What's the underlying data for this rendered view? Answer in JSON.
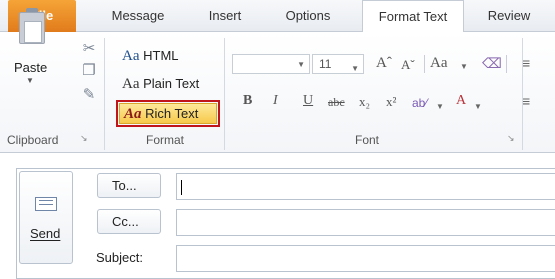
{
  "tabs": [
    {
      "label": "File"
    },
    {
      "label": "Message"
    },
    {
      "label": "Insert"
    },
    {
      "label": "Options"
    },
    {
      "label": "Format Text"
    },
    {
      "label": "Review"
    }
  ],
  "ribbon": {
    "clipboard": {
      "paste_label": "Paste",
      "group_label": "Clipboard"
    },
    "format": {
      "group_label": "Format",
      "html_label": "HTML",
      "plain_label": "Plain Text",
      "rich_label": "Rich Text",
      "aa_glyph": "Aa",
      "selected": "Rich Text"
    },
    "font": {
      "group_label": "Font",
      "font_size": "11",
      "bold": "B",
      "italic": "I",
      "underline": "U",
      "strike": "abc",
      "subscript": "x₂",
      "superscript": "x²",
      "grow": "Aˆ",
      "shrink": "Aˇ",
      "change_case": "Aa",
      "font_color": "A"
    }
  },
  "compose": {
    "send_label": "Send",
    "to_label": "To...",
    "cc_label": "Cc...",
    "subject_label": "Subject:",
    "to_value": "",
    "cc_value": "",
    "subject_value": ""
  },
  "colors": {
    "file_tab": "#e17b1c",
    "highlight_border": "#c0151a",
    "selected_fill": "#f7c94c"
  }
}
